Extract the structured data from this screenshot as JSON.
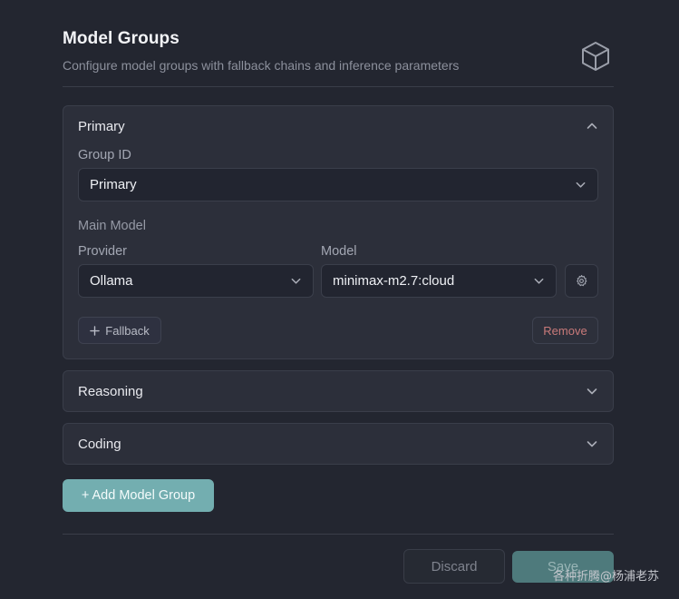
{
  "header": {
    "title": "Model Groups",
    "subtitle": "Configure model groups with fallback chains and inference parameters"
  },
  "groups": [
    {
      "name": "Primary",
      "expanded": true,
      "group_id_label": "Group ID",
      "group_id_value": "Primary",
      "main_model_label": "Main Model",
      "provider_label": "Provider",
      "provider_value": "Ollama",
      "model_label": "Model",
      "model_value": "minimax-m2.7:cloud",
      "fallback_label": "Fallback",
      "remove_label": "Remove"
    },
    {
      "name": "Reasoning",
      "expanded": false
    },
    {
      "name": "Coding",
      "expanded": false
    }
  ],
  "actions": {
    "add_group": "+ Add Model Group",
    "discard": "Discard",
    "save": "Save"
  },
  "watermark": "各种折腾@杨浦老苏",
  "icons": [
    "cube-icon",
    "chevron-up-icon",
    "chevron-down-icon",
    "gear-icon",
    "plus-icon"
  ],
  "colors": {
    "background": "#232630",
    "card": "#2c2f3a",
    "accent": "#73aeb0",
    "danger_text": "#c97a7a"
  }
}
